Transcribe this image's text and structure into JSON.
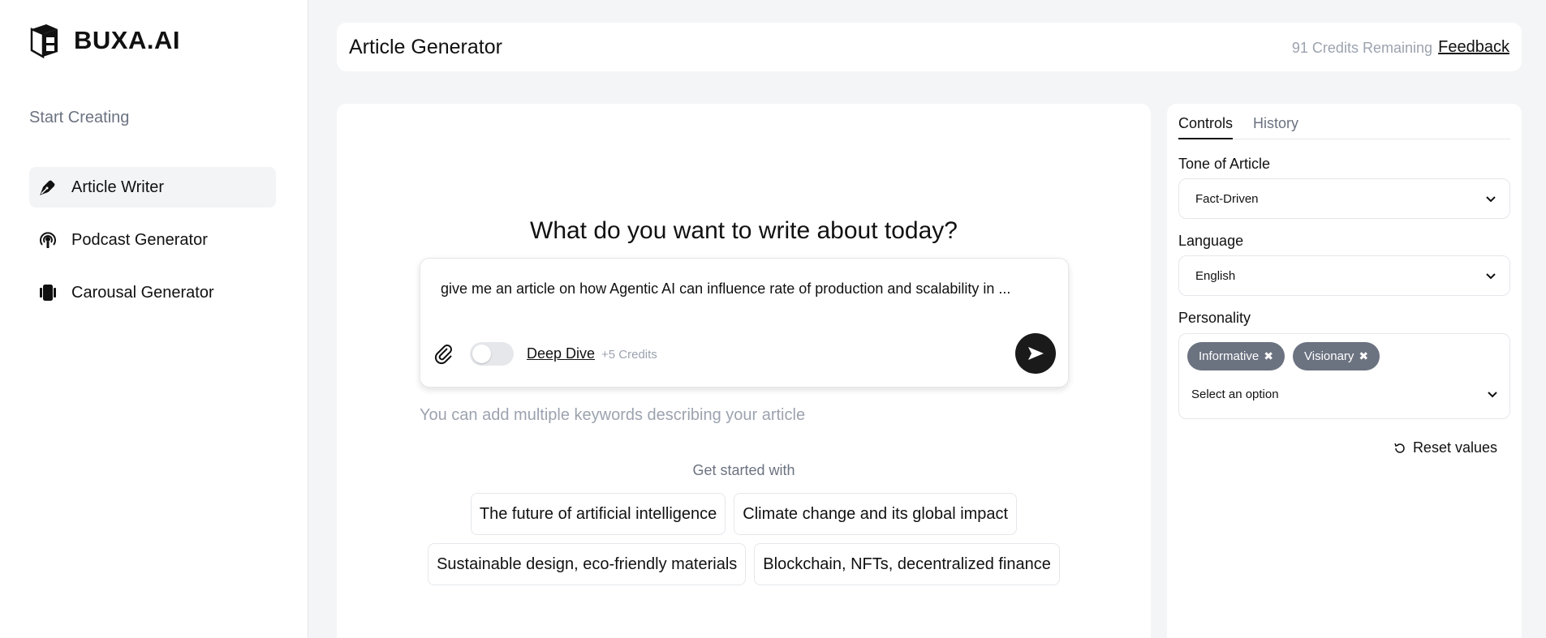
{
  "brand": {
    "name": "BUXA.AI"
  },
  "sidebar": {
    "section_label": "Start Creating",
    "items": [
      {
        "label": "Article Writer",
        "icon": "pen-nib-icon",
        "active": true
      },
      {
        "label": "Podcast Generator",
        "icon": "podcast-icon",
        "active": false
      },
      {
        "label": "Carousal Generator",
        "icon": "carousel-icon",
        "active": false
      }
    ]
  },
  "header": {
    "title": "Article Generator",
    "credits": "91 Credits Remaining",
    "feedback": "Feedback"
  },
  "main": {
    "heading": "What do you want to write about today?",
    "prompt_text": "give me an article on how Agentic AI can influence rate of production and scalability in ...",
    "deep_dive_label": "Deep Dive",
    "deep_dive_credits": "+5 Credits",
    "deep_dive_enabled": false,
    "hint": "You can add multiple keywords describing your article",
    "get_started": "Get started with",
    "suggestions": [
      "The future of artificial intelligence",
      "Climate change and its global impact",
      "Sustainable design, eco-friendly materials",
      "Blockchain, NFTs, decentralized finance"
    ]
  },
  "controls": {
    "tabs": [
      "Controls",
      "History"
    ],
    "tone_label": "Tone of Article",
    "tone_value": "Fact-Driven",
    "language_label": "Language",
    "language_value": "English",
    "personality_label": "Personality",
    "personality_tags": [
      "Informative",
      "Visionary"
    ],
    "personality_placeholder": "Select an option",
    "reset_label": "Reset values"
  },
  "colors": {
    "accent": "#1a1a1a",
    "tag_bg": "#6b7280",
    "muted_text": "#9ca3af"
  }
}
